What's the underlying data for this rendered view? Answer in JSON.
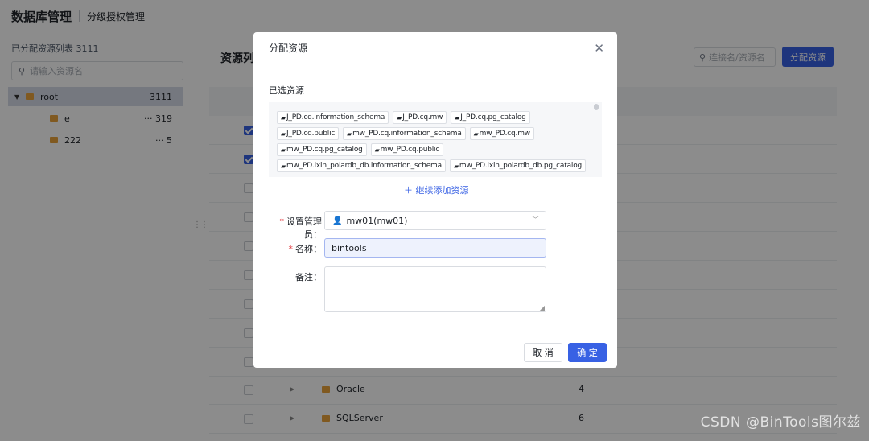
{
  "header": {
    "title": "数据库管理",
    "subtitle": "分级授权管理"
  },
  "left": {
    "count_label": "已分配资源列表 3111",
    "search_placeholder": "请输入资源名",
    "tree": [
      {
        "label": "root",
        "count": "3111"
      },
      {
        "label": "e",
        "count": "··· 319"
      },
      {
        "label": "222",
        "count": "··· 5"
      }
    ]
  },
  "main": {
    "title": "资源列",
    "search_placeholder": "连接名/资源名",
    "assign_button": "分配资源",
    "rows": [
      {
        "name": "Oracle",
        "count": "4"
      },
      {
        "name": "SQLServer",
        "count": "6"
      }
    ]
  },
  "modal": {
    "title": "分配资源",
    "close": "✕",
    "selected_label": "已选资源",
    "tags": [
      "J_PD.cq.information_schema",
      "J_PD.cq.mw",
      "J_PD.cq.pg_catalog",
      "J_PD.cq.public",
      "mw_PD.cq.information_schema",
      "mw_PD.cq.mw",
      "mw_PD.cq.pg_catalog",
      "mw_PD.cq.public",
      "mw_PD.lxin_polardb_db.information_schema",
      "mw_PD.lxin_polardb_db.pg_catalog"
    ],
    "add_more": "＋ 继续添加资源",
    "admin_label": "设置管理员：",
    "admin_value": "mw01(mw01)",
    "name_label": "名称：",
    "name_value": "bintools",
    "remark_label": "备注：",
    "cancel": "取 消",
    "confirm": "确 定"
  },
  "watermark": "CSDN @BinTools图尔兹",
  "colors": {
    "primary": "#3861e4",
    "folder": "#e9a23b",
    "required": "#e5484d"
  }
}
